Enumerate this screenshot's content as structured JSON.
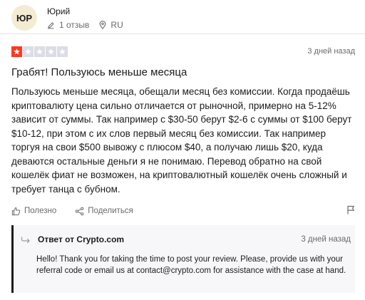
{
  "reviewer": {
    "initials": "ЮР",
    "name": "Юрий",
    "reviews_count": "1 отзыв",
    "country": "RU"
  },
  "review": {
    "rating": 1,
    "max_rating": 5,
    "date": "3 дней назад",
    "title": "Грабят! Пользуюсь меньше месяца",
    "body": "Пользуюсь меньше месяца, обещали месяц без комиссии. Когда продаёшь криптовалюту цена сильно отличается от рыночной, примерно на 5-12% зависит от суммы. Так например с $30-50 берут $2-6 с суммы от $100 берут $10-12, при этом с их слов первый месяц без комиссии. Так например торгуя на свои $500 вывожу с плюсом $40, а получаю лишь $20, куда деваются остальные деньги я не понимаю. Перевод обратно на свой кошелёк фиат не возможен, на криптовалютный кошелёк очень сложный и требует танца с бубном.",
    "star_color_active": "#ff3722",
    "star_color_inactive": "#dcdce6"
  },
  "actions": {
    "useful_label": "Полезно",
    "share_label": "Поделиться"
  },
  "reply": {
    "title": "Ответ от Crypto.com",
    "date": "3 дней назад",
    "text": "Hello! Thank you for taking the time to post your review. Please, provide us with your referral code or email us at contact@crypto.com for assistance with the case at hand."
  }
}
